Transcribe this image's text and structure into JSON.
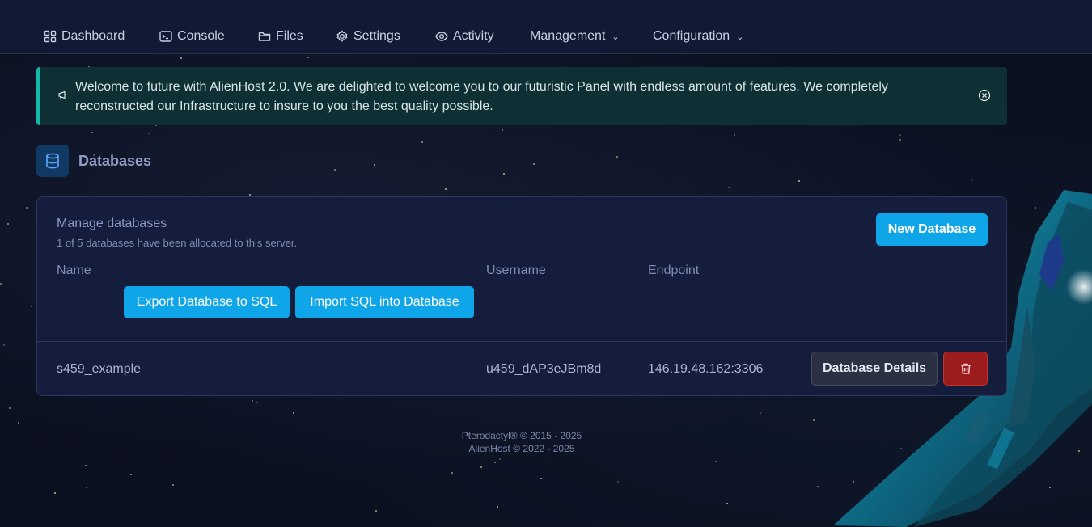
{
  "nav": {
    "items": [
      {
        "label": "Dashboard",
        "icon": "grid-icon"
      },
      {
        "label": "Console",
        "icon": "terminal-icon"
      },
      {
        "label": "Files",
        "icon": "folder-icon"
      },
      {
        "label": "Settings",
        "icon": "gear-icon"
      },
      {
        "label": "Activity",
        "icon": "eye-icon"
      },
      {
        "label": "Management",
        "icon": "chevron-down-icon"
      },
      {
        "label": "Configuration",
        "icon": "chevron-down-icon"
      }
    ]
  },
  "alert": {
    "text": "Welcome to future with AlienHost 2.0. We are delighted to welcome you to our futuristic Panel with endless amount of features. We completely reconstructed our Infrastructure to insure to you the best quality possible.",
    "icon": "megaphone-icon",
    "close_icon": "close-circle-icon",
    "accent": "#14b8a6"
  },
  "page": {
    "title": "Databases",
    "icon": "database-icon"
  },
  "card": {
    "heading": "Manage databases",
    "subtitle": "1 of 5 databases have been allocated to this server.",
    "new_button": "New Database",
    "export_button": "Export Database to SQL",
    "import_button": "Import SQL into Database",
    "columns": {
      "name": "Name",
      "username": "Username",
      "endpoint": "Endpoint"
    },
    "rows": [
      {
        "name": "s459_example",
        "username": "u459_dAP3eJBm8d",
        "endpoint": "146.19.48.162:3306",
        "details_button": "Database Details",
        "delete_icon": "trash-icon"
      }
    ]
  },
  "footer": {
    "line1": "Pterodactyl® © 2015 - 2025",
    "line2": "AlienHost © 2022 - 2025"
  },
  "colors": {
    "primary": "#0ea5e9",
    "danger": "#9b1c1c",
    "nav_bg": "#121a33",
    "card_bg": "#141d3b"
  }
}
